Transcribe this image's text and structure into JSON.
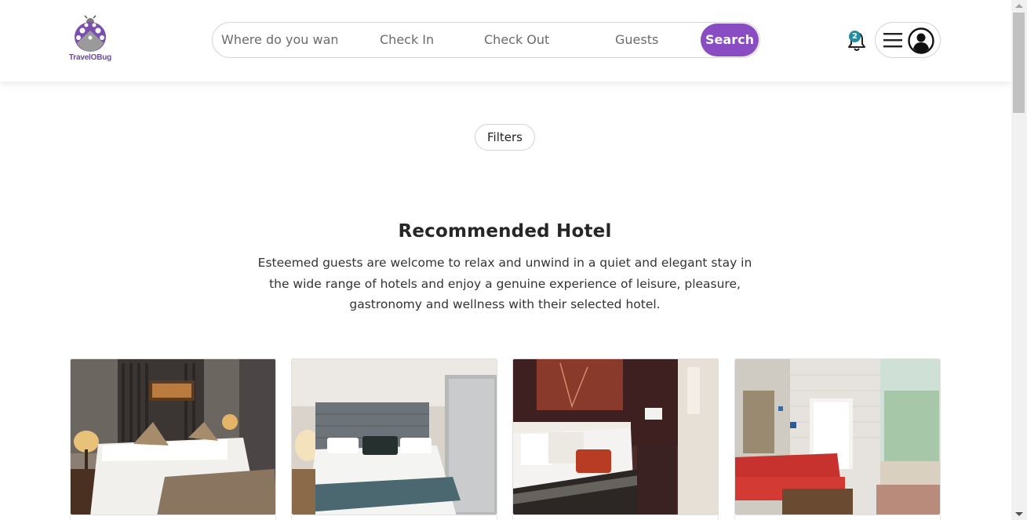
{
  "header": {
    "logo": {
      "text": "TravelOBug",
      "icon": "ladybug-logo-icon"
    },
    "search": {
      "where_placeholder": "Where do you wan",
      "checkin_label": "Check In",
      "checkout_label": "Check Out",
      "guests_label": "Guests",
      "search_button": "Search"
    },
    "notifications": {
      "icon": "bell-icon",
      "count": "2"
    },
    "user_menu": {
      "menu_icon": "hamburger-icon",
      "avatar_icon": "user-circle-icon"
    }
  },
  "filters": {
    "label": "Filters"
  },
  "section": {
    "title": "Recommended Hotel",
    "description": "Esteemed guests are welcome to relax and unwind in a quiet and elegant stay in the wide range of hotels and enjoy a genuine experience of leisure, pleasure, gastronomy and wellness with their selected hotel."
  },
  "hotels": [
    {
      "image": "hotel-room-photo-1"
    },
    {
      "image": "hotel-room-photo-2"
    },
    {
      "image": "hotel-room-photo-3"
    },
    {
      "image": "hotel-room-photo-4"
    }
  ],
  "colors": {
    "accent": "#8a4cc2",
    "badge": "#1e8fa6",
    "logo": "#6a4a9e"
  }
}
